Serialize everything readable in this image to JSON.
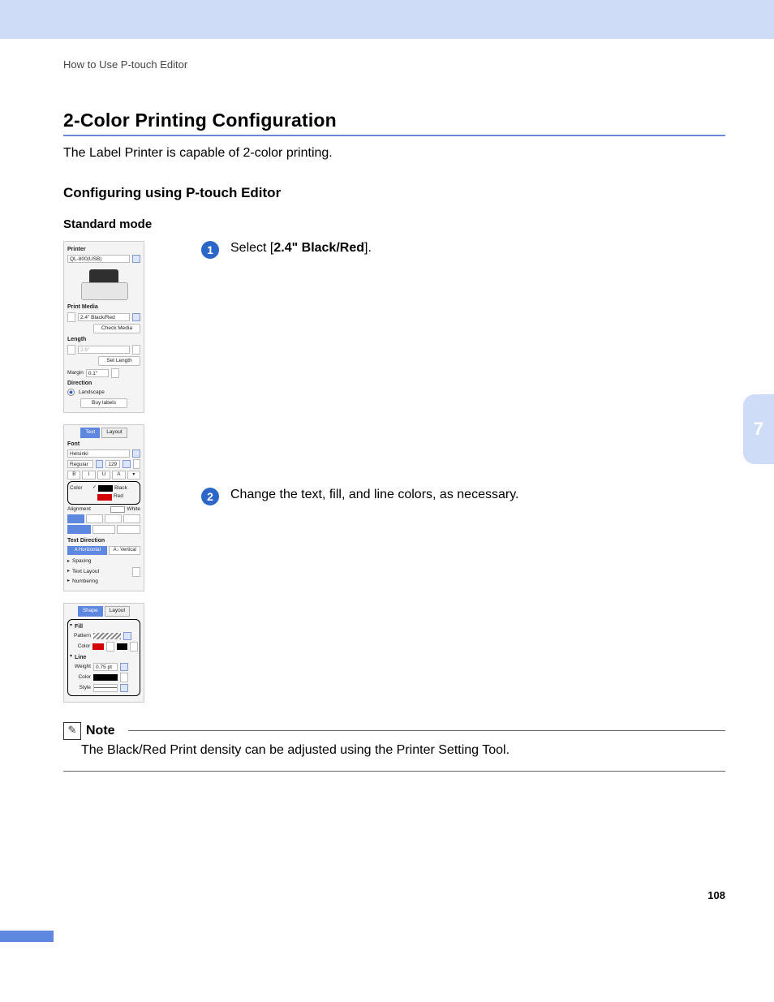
{
  "header": {
    "breadcrumb": "How to Use P-touch Editor"
  },
  "titles": {
    "section": "2-Color Printing Configuration",
    "intro": "The Label Printer is capable of 2-color printing.",
    "subsection": "Configuring using P-touch Editor",
    "mode": "Standard mode"
  },
  "chapter_tab": "7",
  "steps": {
    "s1_prefix": "Select [",
    "s1_bold": "2.4\" Black/Red",
    "s1_suffix": "].",
    "s2": "Change the text, fill, and line colors, as necessary."
  },
  "note": {
    "label": "Note",
    "body": "The Black/Red Print density can be adjusted using the Printer Setting Tool."
  },
  "footer": {
    "page": "108"
  },
  "panel_printer": {
    "title": "Printer",
    "device": "QL-800(USB)",
    "media_title": "Print Media",
    "media_value": "2.4\" Black/Red",
    "check_media": "Check Media",
    "length_title": "Length",
    "length_value": "2.6\"",
    "set_length": "Set Length",
    "margin_label": "Margin",
    "margin_value": "0.1\"",
    "direction_title": "Direction",
    "direction_opt": "Landscape",
    "buy": "Buy labels"
  },
  "panel_text": {
    "tab_text": "Text",
    "tab_layout": "Layout",
    "font_title": "Font",
    "font_name": "Helsinki",
    "style": "Regular",
    "size": "129",
    "b": "B",
    "i": "I",
    "u": "U",
    "a": "A",
    "color_label": "Color",
    "color_black": "Black",
    "color_red": "Red",
    "color_white": "White",
    "align_label": "Alignment",
    "dir_title": "Text Direction",
    "dir_h": "Horizontal",
    "dir_v": "Vertical",
    "spacing": "Spacing",
    "textlayout": "Text Layout",
    "numbering": "Numbering"
  },
  "panel_shape": {
    "tab_shape": "Shape",
    "tab_layout": "Layout",
    "fill_title": "Fill",
    "pattern_label": "Pattern",
    "color_label": "Color",
    "line_title": "Line",
    "weight_label": "Weight",
    "weight_value": "0.75 pt",
    "style_label": "Style"
  }
}
